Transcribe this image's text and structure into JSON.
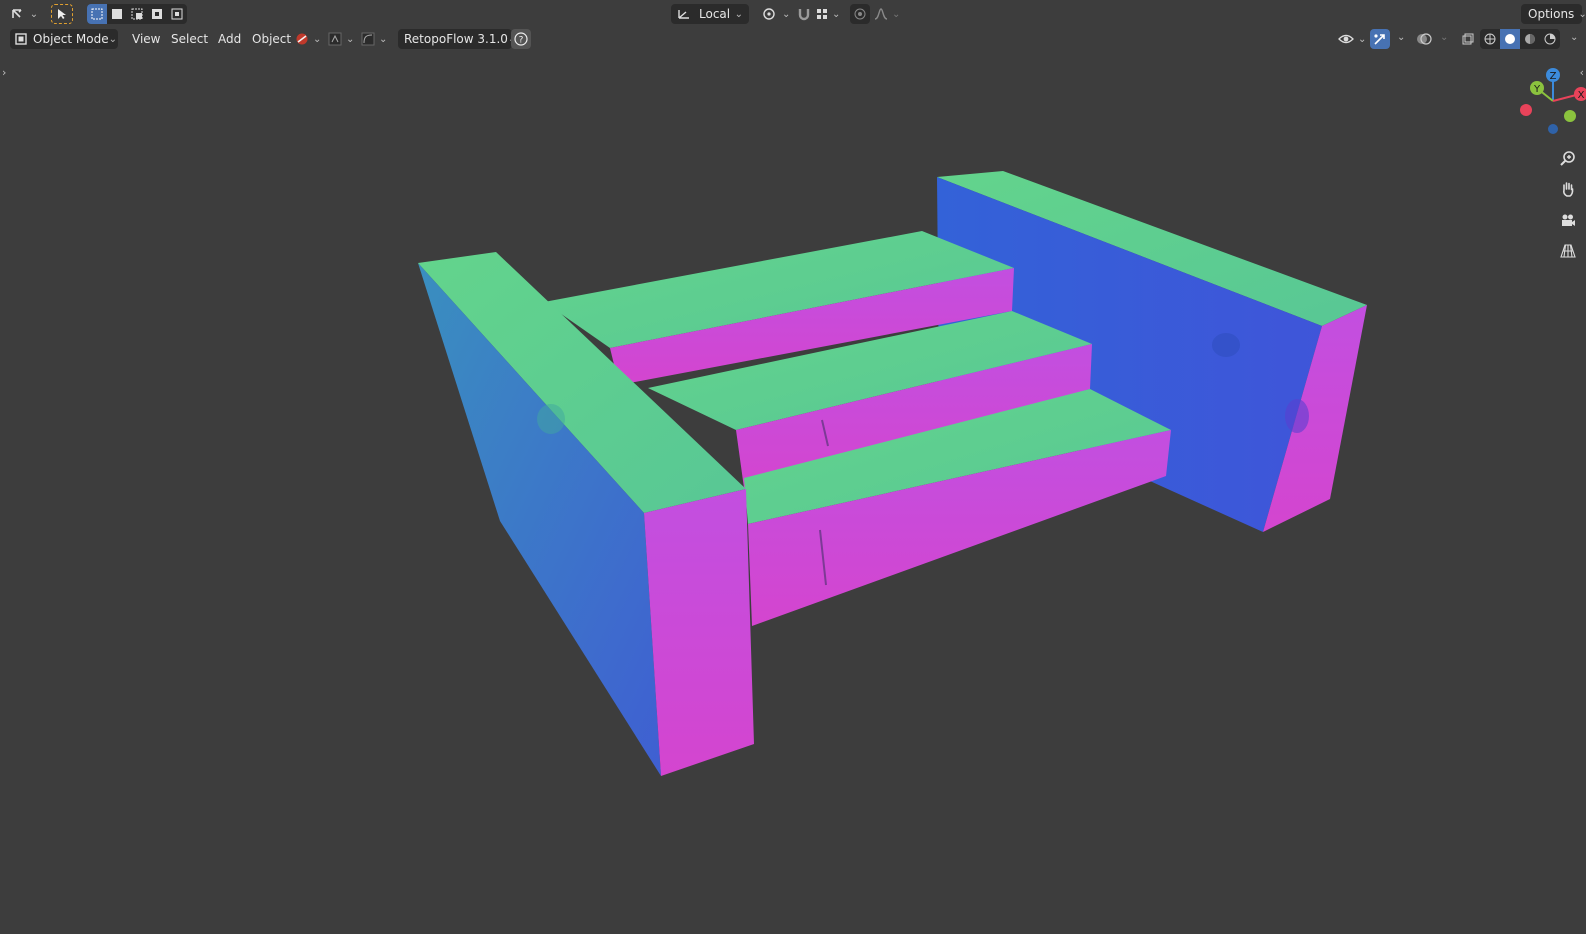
{
  "header_row1": {
    "editor_type_icon": "viewport-editor-icon",
    "transform_orientation": "Local",
    "options_label": "Options"
  },
  "header_row2": {
    "mode_label": "Object Mode",
    "menus": [
      "View",
      "Select",
      "Add",
      "Object"
    ],
    "addon_label": "RetopoFlow 3.1.0",
    "help_icon": "help-icon"
  },
  "gizmo": {
    "axes": [
      "Z",
      "Y",
      "X"
    ],
    "colors": {
      "x": "#e8435a",
      "y": "#8bc33e",
      "z": "#3c8bdc",
      "neg_x": "#e8435a",
      "neg_y": "#8bc33e",
      "neg_z": "#2f62a8"
    }
  },
  "navigation": [
    "zoom-icon",
    "pan-hand-icon",
    "camera-icon",
    "perspective-grid-icon"
  ],
  "model": {
    "colors": {
      "top": "#5fd98e",
      "front": "#d64ad6",
      "side": "#3f63d6",
      "background": "#3d3d3d"
    }
  }
}
